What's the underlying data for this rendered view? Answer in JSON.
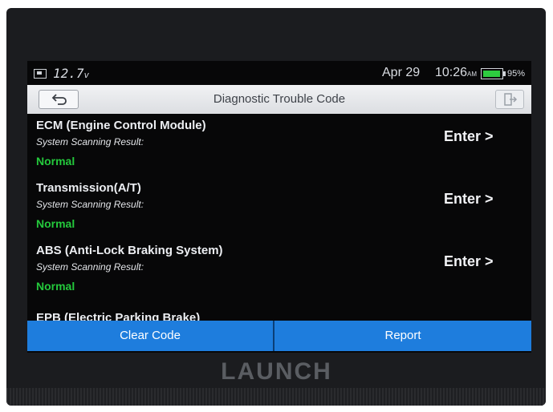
{
  "status": {
    "voltage": "12.7",
    "voltage_unit": "v",
    "date": "Apr 29",
    "time": "10:26",
    "ampm": "AM",
    "battery_percent": "95%",
    "battery_level": 0.95
  },
  "header": {
    "title": "Diagnostic Trouble Code",
    "back_icon": "back-arrow-icon",
    "exit_icon": "exit-icon"
  },
  "modules": [
    {
      "name": "ECM (Engine Control Module)",
      "scan_label": "System Scanning Result:",
      "status": "Normal",
      "action": "Enter >"
    },
    {
      "name": "Transmission(A/T)",
      "scan_label": "System Scanning Result:",
      "status": "Normal",
      "action": "Enter >"
    },
    {
      "name": "ABS (Anti-Lock Braking System)",
      "scan_label": "System Scanning Result:",
      "status": "Normal",
      "action": "Enter >"
    },
    {
      "name": "EPB (Electric Parking Brake)"
    }
  ],
  "footer": {
    "clear_label": "Clear Code",
    "report_label": "Report"
  },
  "brand": "LAUNCH",
  "colors": {
    "status_normal": "#24c93c",
    "button_blue": "#1e7ddd",
    "screen_bg": "#070708"
  }
}
